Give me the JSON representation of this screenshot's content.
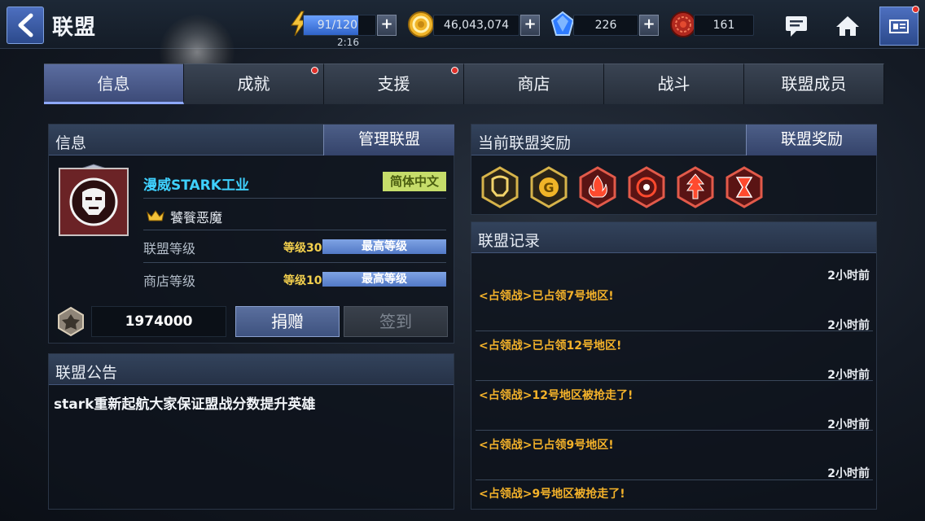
{
  "header": {
    "title": "联盟",
    "energy": {
      "value": "91/120",
      "fraction": 0.76,
      "timer": "2:16"
    },
    "gold": "46,043,074",
    "crystals": "226",
    "tokens": "161"
  },
  "tabs": [
    {
      "label": "信息",
      "active": true,
      "dot": false
    },
    {
      "label": "成就",
      "active": false,
      "dot": true
    },
    {
      "label": "支援",
      "active": false,
      "dot": true
    },
    {
      "label": "商店",
      "active": false,
      "dot": false
    },
    {
      "label": "战斗",
      "active": false,
      "dot": false
    },
    {
      "label": "联盟成员",
      "active": false,
      "dot": false
    }
  ],
  "info": {
    "header_title": "信息",
    "manage_button": "管理联盟",
    "alliance_name": "漫威STARK工业",
    "language": "简体中文",
    "leader": "饕餮恶魔",
    "alliance_level_label": "联盟等级",
    "alliance_level_value": "等级30",
    "alliance_level_status": "最高等级",
    "shop_level_label": "商店等级",
    "shop_level_value": "等级10",
    "shop_level_status": "最高等级",
    "donation_amount": "1974000",
    "donate_button": "捐赠",
    "checkin_button": "签到"
  },
  "notice": {
    "header_title": "联盟公告",
    "text": "stark重新起航大家保证盟战分数提升英雄"
  },
  "rewards": {
    "header_title": "当前联盟奖励",
    "button": "联盟奖励",
    "icons": [
      "iron-man-emblem",
      "gold-g-emblem",
      "fire-emblem",
      "target-emblem",
      "arrows-up-emblem",
      "hourglass-emblem"
    ]
  },
  "log": {
    "header_title": "联盟记录",
    "entries": [
      {
        "time": "2小时前",
        "message": "<占领战>已占领7号地区!"
      },
      {
        "time": "2小时前",
        "message": "<占领战>已占领12号地区!"
      },
      {
        "time": "2小时前",
        "message": "<占领战>12号地区被抢走了!"
      },
      {
        "time": "2小时前",
        "message": "<占领战>已占领9号地区!"
      },
      {
        "time": "2小时前",
        "message": "<占领战>9号地区被抢走了!"
      }
    ]
  },
  "colors": {
    "accent": "#3fd1ff",
    "log_message": "#f4b22a",
    "level_text": "#f2cf4d",
    "language_tag": "#c6dd6a"
  }
}
